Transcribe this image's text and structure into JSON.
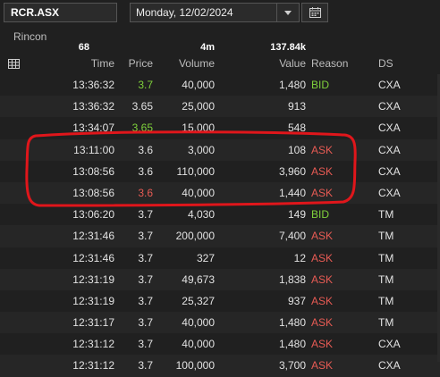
{
  "toolbar": {
    "symbol": "RCR.ASX",
    "date": "Monday, 12/02/2024"
  },
  "company": "Rincon",
  "summary": {
    "count": "68",
    "time_span": "4m",
    "value_total": "137.84k"
  },
  "columns": {
    "time": "Time",
    "price": "Price",
    "volume": "Volume",
    "value": "Value",
    "reason": "Reason",
    "ds": "DS"
  },
  "trades": [
    {
      "time": "13:36:32",
      "price": "3.7",
      "volume": "40,000",
      "value": "1,480",
      "reason": "BID",
      "ds": "CXA",
      "price_tone": "up"
    },
    {
      "time": "13:36:32",
      "price": "3.65",
      "volume": "25,000",
      "value": "913",
      "reason": "",
      "ds": "CXA",
      "price_tone": ""
    },
    {
      "time": "13:34:07",
      "price": "3.65",
      "volume": "15,000",
      "value": "548",
      "reason": "",
      "ds": "CXA",
      "price_tone": "up"
    },
    {
      "time": "13:11:00",
      "price": "3.6",
      "volume": "3,000",
      "value": "108",
      "reason": "ASK",
      "ds": "CXA",
      "price_tone": ""
    },
    {
      "time": "13:08:56",
      "price": "3.6",
      "volume": "110,000",
      "value": "3,960",
      "reason": "ASK",
      "ds": "CXA",
      "price_tone": ""
    },
    {
      "time": "13:08:56",
      "price": "3.6",
      "volume": "40,000",
      "value": "1,440",
      "reason": "ASK",
      "ds": "CXA",
      "price_tone": "down"
    },
    {
      "time": "13:06:20",
      "price": "3.7",
      "volume": "4,030",
      "value": "149",
      "reason": "BID",
      "ds": "TM",
      "price_tone": ""
    },
    {
      "time": "12:31:46",
      "price": "3.7",
      "volume": "200,000",
      "value": "7,400",
      "reason": "ASK",
      "ds": "TM",
      "price_tone": ""
    },
    {
      "time": "12:31:46",
      "price": "3.7",
      "volume": "327",
      "value": "12",
      "reason": "ASK",
      "ds": "TM",
      "price_tone": ""
    },
    {
      "time": "12:31:19",
      "price": "3.7",
      "volume": "49,673",
      "value": "1,838",
      "reason": "ASK",
      "ds": "TM",
      "price_tone": ""
    },
    {
      "time": "12:31:19",
      "price": "3.7",
      "volume": "25,327",
      "value": "937",
      "reason": "ASK",
      "ds": "TM",
      "price_tone": ""
    },
    {
      "time": "12:31:17",
      "price": "3.7",
      "volume": "40,000",
      "value": "1,480",
      "reason": "ASK",
      "ds": "TM",
      "price_tone": ""
    },
    {
      "time": "12:31:12",
      "price": "3.7",
      "volume": "40,000",
      "value": "1,480",
      "reason": "ASK",
      "ds": "CXA",
      "price_tone": ""
    },
    {
      "time": "12:31:12",
      "price": "3.7",
      "volume": "100,000",
      "value": "3,700",
      "reason": "ASK",
      "ds": "CXA",
      "price_tone": ""
    }
  ],
  "colors": {
    "bid": "#7fd13b",
    "ask": "#e85b54",
    "annotation": "#e0161b"
  }
}
